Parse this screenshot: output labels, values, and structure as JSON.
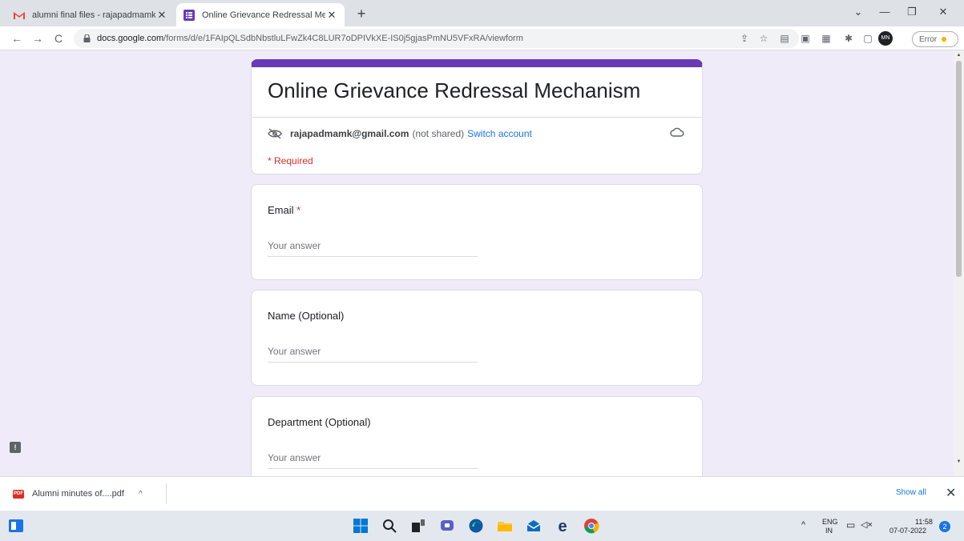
{
  "browser": {
    "tabs": [
      {
        "title": "alumni final files - rajapadmamk",
        "favicon": "gmail-icon",
        "active": false
      },
      {
        "title": "Online Grievance Redressal Mech",
        "favicon": "google-forms-icon",
        "active": true
      }
    ],
    "url_domain": "docs.google.com",
    "url_path": "/forms/d/e/1FAIpQLSdbNbstluLFwZk4C8LUR7oDPIVkXE-IS0j5gjasPmNU5VFxRA/viewform",
    "profile_error_label": "Error"
  },
  "form": {
    "title": "Online Grievance Redressal Mechanism",
    "account_email": "rajapadmamk@gmail.com",
    "not_shared": "(not shared)",
    "switch_account": "Switch account",
    "required_note": "* Required",
    "accent_color": "#673ab7",
    "questions": [
      {
        "label": "Email",
        "required_mark": "*",
        "placeholder": "Your answer"
      },
      {
        "label": "Name (Optional)",
        "placeholder": "Your answer"
      },
      {
        "label": "Department (Optional)",
        "placeholder": "Your answer"
      }
    ]
  },
  "downloads": {
    "item": "Alumni minutes of....pdf",
    "show_all": "Show all"
  },
  "taskbar": {
    "lang": "ENG",
    "region": "IN",
    "time": "11:58",
    "date": "07-07-2022",
    "notification_count": "2"
  }
}
